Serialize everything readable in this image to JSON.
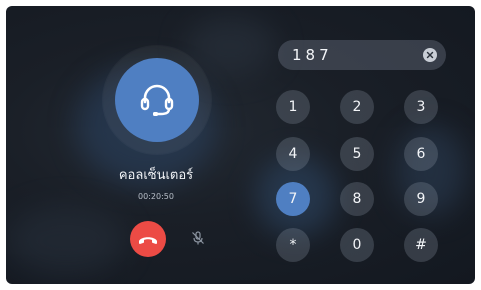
{
  "caller": {
    "name": "คอลเซ็นเตอร์",
    "duration": "00:20:50",
    "avatar_icon": "headset-icon"
  },
  "dialer": {
    "number": "187",
    "keys": [
      {
        "label": "1"
      },
      {
        "label": "2"
      },
      {
        "label": "3"
      },
      {
        "label": "4"
      },
      {
        "label": "5"
      },
      {
        "label": "6"
      },
      {
        "label": "7",
        "active": true
      },
      {
        "label": "8"
      },
      {
        "label": "9"
      },
      {
        "label": "*"
      },
      {
        "label": "0"
      },
      {
        "label": "#"
      }
    ]
  },
  "controls": {
    "hangup_icon": "phone-hangup-icon",
    "mute_icon": "mic-off-icon",
    "clear_icon": "clear-icon"
  },
  "colors": {
    "accent": "#4f7fc2",
    "hangup": "#ec4b45",
    "background": "#1a1f27"
  }
}
